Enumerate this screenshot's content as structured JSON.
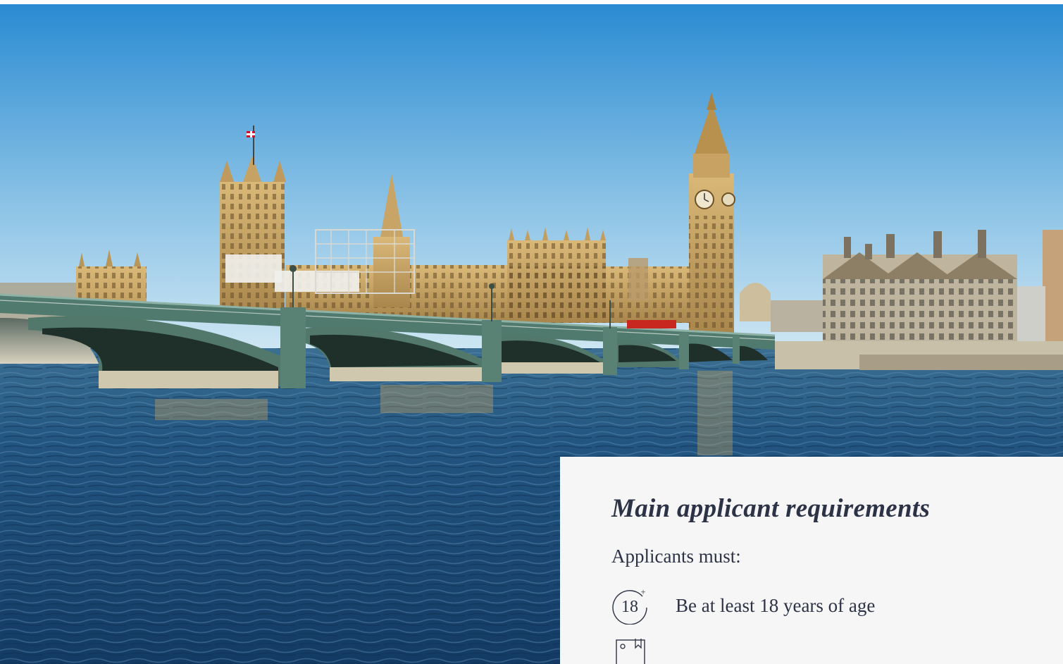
{
  "hero": {
    "image": "london-westminster-bridge-big-ben-photo",
    "colors": {
      "sky_top": "#2e8ed4",
      "sky_bottom": "#cfe6f3",
      "water": "#1e4f78",
      "stone": "#c9a465",
      "bridge": "#4f7a6d"
    }
  },
  "requirements": {
    "title": "Main applicant requirements",
    "intro": "Applicants must:",
    "items": [
      {
        "icon": "age-18-plus-icon",
        "icon_text": "18",
        "icon_sup": "+",
        "label": "Be at least 18 years of age"
      },
      {
        "icon": "passport-document-icon",
        "label": ""
      }
    ]
  },
  "colors": {
    "text": "#2d3346",
    "card_bg": "#f6f6f6"
  }
}
